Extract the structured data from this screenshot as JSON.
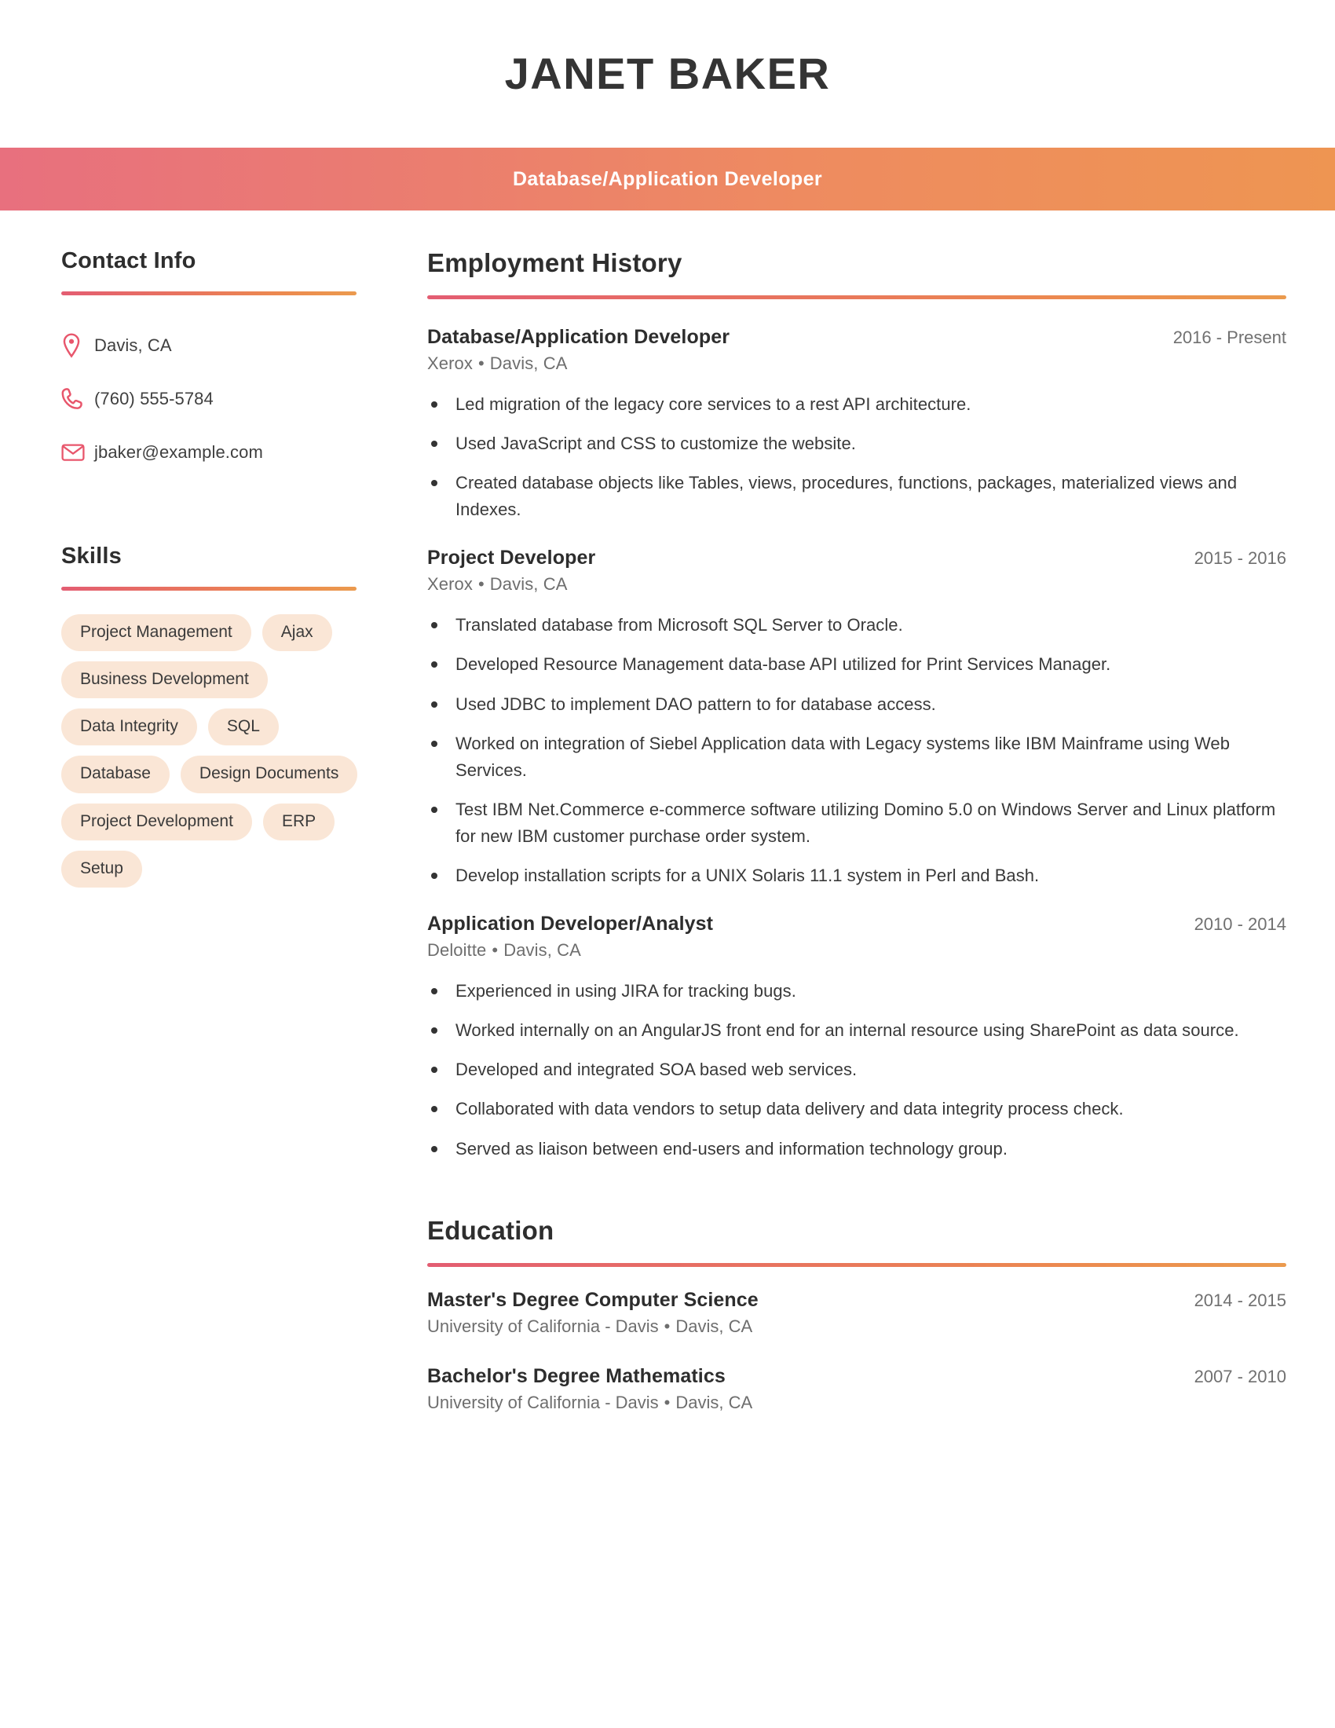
{
  "header": {
    "name": "JANET BAKER",
    "title": "Database/Application Developer",
    "gradient_start": "#e8707e",
    "gradient_end": "#ee9552",
    "name_color": "#343434",
    "title_color": "#ffffff"
  },
  "sidebar": {
    "contact": {
      "heading": "Contact Info",
      "items": [
        {
          "icon": "map-pin-icon",
          "value": "Davis, CA"
        },
        {
          "icon": "phone-icon",
          "value": "(760) 555-5784"
        },
        {
          "icon": "envelope-icon",
          "value": "jbaker@example.com"
        }
      ]
    },
    "skills": {
      "heading": "Skills",
      "pill_background": "#fae6d6",
      "items": [
        "Project Management",
        "Ajax",
        "Business Development",
        "Data Integrity",
        "SQL",
        "Database",
        "Design Documents",
        "Project Development",
        "ERP",
        "Setup"
      ]
    }
  },
  "main": {
    "employment": {
      "heading": "Employment History",
      "jobs": [
        {
          "title": "Database/Application Developer",
          "dates": "2016 - Present",
          "company": "Xerox",
          "location": "Davis, CA",
          "bullets": [
            "Led migration of the legacy core services to a rest API architecture.",
            "Used JavaScript and CSS to customize the website.",
            "Created database objects like Tables, views, procedures, functions, packages, materialized views and Indexes."
          ]
        },
        {
          "title": "Project Developer",
          "dates": "2015 - 2016",
          "company": "Xerox",
          "location": "Davis, CA",
          "bullets": [
            "Translated database from Microsoft SQL Server to Oracle.",
            "Developed Resource Management data-base API utilized for Print Services Manager.",
            "Used JDBC to implement DAO pattern to for database access.",
            "Worked on integration of Siebel Application data with Legacy systems like IBM Mainframe using Web Services.",
            "Test IBM Net.Commerce e-commerce software utilizing Domino 5.0 on Windows Server and Linux platform for new IBM customer purchase order system.",
            "Develop installation scripts for a UNIX Solaris 11.1 system in Perl and Bash."
          ]
        },
        {
          "title": "Application Developer/Analyst",
          "dates": "2010 - 2014",
          "company": "Deloitte",
          "location": "Davis, CA",
          "bullets": [
            "Experienced in using JIRA for tracking bugs.",
            "Worked internally on an AngularJS front end for an internal resource using SharePoint as data source.",
            "Developed and integrated SOA based web services.",
            "Collaborated with data vendors to setup data delivery and data integrity process check.",
            "Served as liaison between end-users and information technology group."
          ]
        }
      ]
    },
    "education": {
      "heading": "Education",
      "items": [
        {
          "degree": "Master's Degree Computer Science",
          "dates": "2014 - 2015",
          "school": "University of California - Davis",
          "location": "Davis, CA"
        },
        {
          "degree": "Bachelor's Degree Mathematics",
          "dates": "2007 - 2010",
          "school": "University of California - Davis",
          "location": "Davis, CA"
        }
      ]
    }
  },
  "separator": "•"
}
